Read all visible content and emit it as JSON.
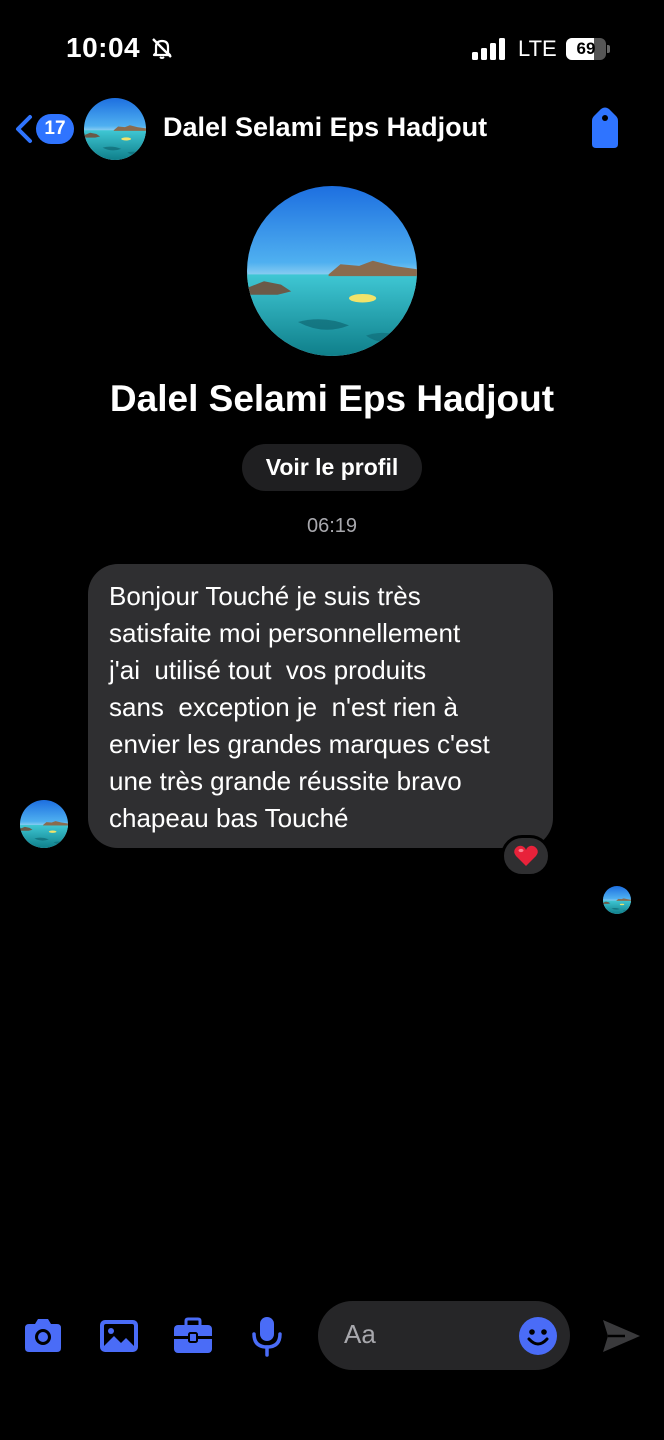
{
  "status_bar": {
    "time": "10:04",
    "network": "LTE",
    "battery_percent": "69",
    "battery_level": 0.69
  },
  "header": {
    "unread_count": "17",
    "contact_name": "Dalel Selami Eps Hadjout"
  },
  "profile": {
    "name": "Dalel Selami Eps Hadjout",
    "view_profile_label": "Voir le profil"
  },
  "conversation": {
    "timestamp": "06:19",
    "message_lines": [
      "Bonjour Touché je suis très",
      "satisfaite moi personnellement",
      "j'ai  utilisé tout  vos produits",
      "sans  exception je  n'est rien à",
      "envier les grandes marques c'est",
      "une très grande réussite bravo",
      "chapeau bas Touché"
    ],
    "reaction": "heart-icon"
  },
  "composer": {
    "placeholder": "Aa"
  },
  "colors": {
    "background": "#000000",
    "accent": "#2f74ff",
    "composer_icon": "#4a6cf7",
    "bubble": "#2f2f31",
    "secondary_text": "#a8a8ad",
    "reaction_heart": "#e8223a"
  },
  "icons": [
    "bell-off-icon",
    "signal-icon",
    "battery-icon",
    "chevron-left-icon",
    "tag-icon",
    "camera-icon",
    "gallery-icon",
    "briefcase-icon",
    "mic-icon",
    "emoji-icon",
    "send-icon",
    "heart-icon"
  ]
}
